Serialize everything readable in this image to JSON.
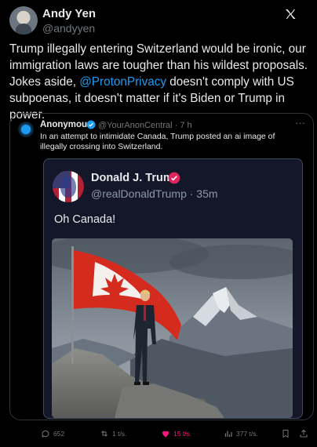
{
  "author": {
    "name": "Andy Yen",
    "handle": "@andyyen"
  },
  "post": {
    "text_before": "Trump illegally entering Switzerland would be ironic, our immigration laws are tougher than his wildest proposals. Jokes aside, ",
    "mention": "@ProtonPrivacy",
    "text_after": " doesn't comply with US subpoenas, it doesn't matter if it's Biden or Trump in power."
  },
  "quoted": {
    "name": "Anonymous",
    "handle": "@YourAnonCentral",
    "time": "· 7 h",
    "text": "In an attempt to intimidate Canada, Trump posted an ai image of illegally crossing into Switzerland.",
    "inner": {
      "name": "Donald J. Trump",
      "handle": "@realDonaldTrump",
      "time": "· 35m",
      "text": "Oh Canada!"
    }
  },
  "actions": {
    "replies": "652",
    "reposts": "1 t/s.",
    "likes": "15 t/s.",
    "views": "377 t/s."
  },
  "colors": {
    "accent": "#1d9bf0",
    "like": "#f91880",
    "muted": "#71767b"
  },
  "icons": [
    "x-logo-icon",
    "more-icon",
    "verified-icon",
    "pink-badge-icon",
    "reply-icon",
    "repost-icon",
    "heart-icon",
    "views-icon",
    "bookmark-icon",
    "share-icon"
  ]
}
